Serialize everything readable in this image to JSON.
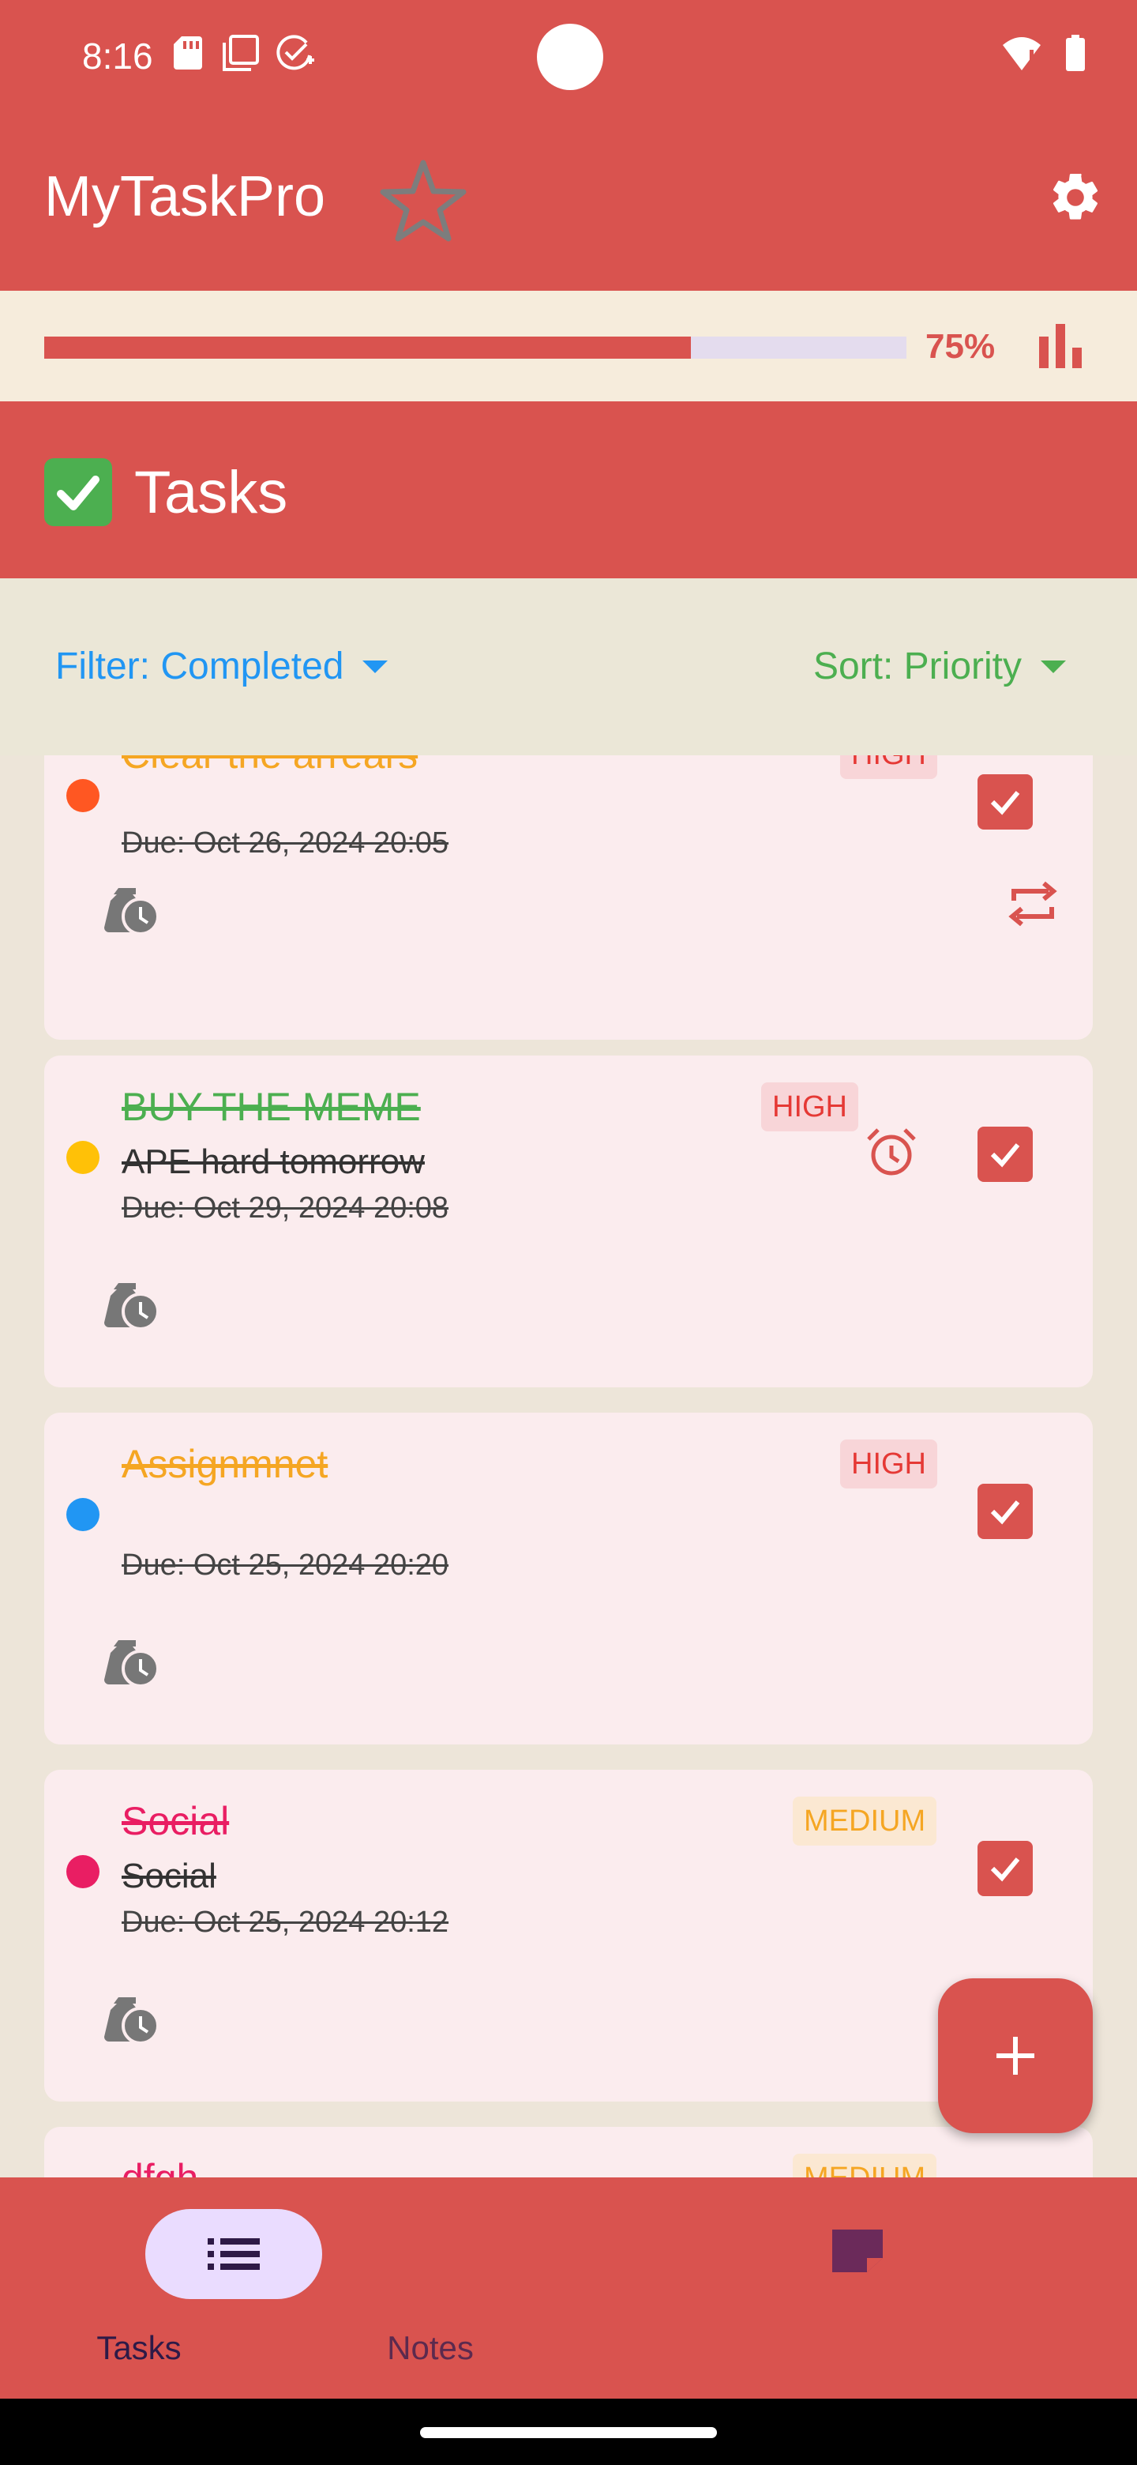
{
  "status_bar": {
    "time": "8:16"
  },
  "app_bar": {
    "title": "MyTaskPro"
  },
  "progress": {
    "value": 0.75,
    "label": "75%"
  },
  "section": {
    "title": "Tasks"
  },
  "filter": {
    "label": "Filter: Completed"
  },
  "sort": {
    "label": "Sort: Priority"
  },
  "tasks": [
    {
      "title": "Clear the arrears",
      "title_color": "#f5a623",
      "dot_color": "#ff5722",
      "description": "",
      "due": "Due: Oct 26, 2024 20:05",
      "priority": "HIGH",
      "has_alarm": false,
      "has_repeat": true,
      "completed": true
    },
    {
      "title": "BUY THE MEME ",
      "title_color": "#4caf50",
      "dot_color": "#ffc107",
      "description": "APE hard tomorrow",
      "due": "Due: Oct 29, 2024 20:08",
      "priority": "HIGH",
      "has_alarm": true,
      "has_repeat": false,
      "completed": true
    },
    {
      "title": "Assignmnet",
      "title_color": "#f5a623",
      "dot_color": "#2196f3",
      "description": "",
      "due": "Due: Oct 25, 2024 20:20",
      "priority": "HIGH",
      "has_alarm": false,
      "has_repeat": false,
      "completed": true
    },
    {
      "title": "Social",
      "title_color": "#e91e63",
      "dot_color": "#e91e63",
      "description": "Social",
      "due": "Due: Oct 25, 2024 20:12",
      "priority": "MEDIUM",
      "has_alarm": false,
      "has_repeat": false,
      "completed": true
    },
    {
      "title": "dfgh",
      "title_color": "#e91e63",
      "priority": "MEDIUM"
    }
  ],
  "bottom_nav": {
    "tasks_label": "Tasks",
    "notes_label": "Notes"
  },
  "colors": {
    "primary": "#d9534f",
    "filter_blue": "#2196f3",
    "sort_green": "#4caf50"
  }
}
